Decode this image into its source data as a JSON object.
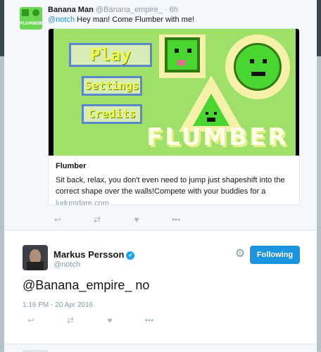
{
  "parent_tweet": {
    "author_name": "Banana Man",
    "handle": "@Banana_empire_",
    "separator": "·",
    "time": "6h",
    "mention": "@notch",
    "text": " Hey man! Come Flumber with me!",
    "avatar_label": "FLUMBER",
    "card": {
      "game_buttons": [
        "Play",
        "Settings",
        "Credits"
      ],
      "game_logo": "FLUMBER",
      "title": "Flumber",
      "description": "Sit back, relax, you don't even need to jump just shapeshift into the correct shape over the walls!Compete with your buddies for a highscore! Provide...",
      "domain": "ludumdare.com"
    },
    "actions": [
      "reply-icon",
      "retweet-icon",
      "like-icon",
      "more-icon"
    ]
  },
  "main_tweet": {
    "author_name": "Markus Persson",
    "handle": "@notch",
    "follow_label": "Following",
    "text": "@Banana_empire_ no",
    "timestamp": "1:16 PM - 20 Apr 2016",
    "actions": [
      "reply-icon",
      "retweet-icon",
      "like-icon",
      "more-icon"
    ]
  },
  "colors": {
    "accent": "#1b95e0",
    "game_green": "#9ee06a",
    "game_text": "#f4ff3b"
  }
}
